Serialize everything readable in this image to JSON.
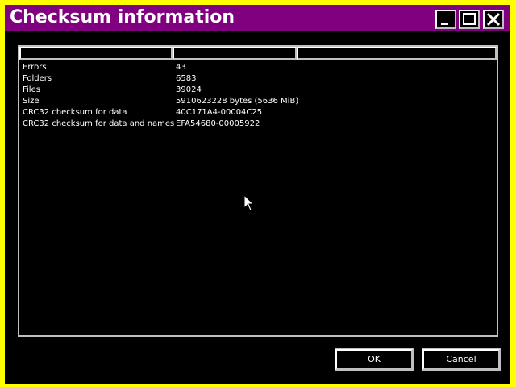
{
  "window": {
    "title": "Checksum information",
    "frame_color": "#ffff00",
    "titlebar_color": "#800080"
  },
  "titlebar_buttons": {
    "minimize_icon": "minimize-icon",
    "maximize_icon": "maximize-icon",
    "close_icon": "close-icon"
  },
  "list": {
    "columns": [
      "",
      "",
      ""
    ],
    "rows": [
      {
        "name": "Errors",
        "value": "43"
      },
      {
        "name": "Folders",
        "value": "6583"
      },
      {
        "name": "Files",
        "value": "39024"
      },
      {
        "name": "Size",
        "value": "5910623228 bytes (5636 MiB)"
      },
      {
        "name": "CRC32 checksum for data",
        "value": "40C171A4-00004C25"
      },
      {
        "name": "CRC32 checksum for data and names",
        "value": "EFA54680-00005922"
      }
    ]
  },
  "buttons": {
    "ok_label": "OK",
    "cancel_label": "Cancel"
  },
  "cursor_icon": "mouse-pointer-icon"
}
